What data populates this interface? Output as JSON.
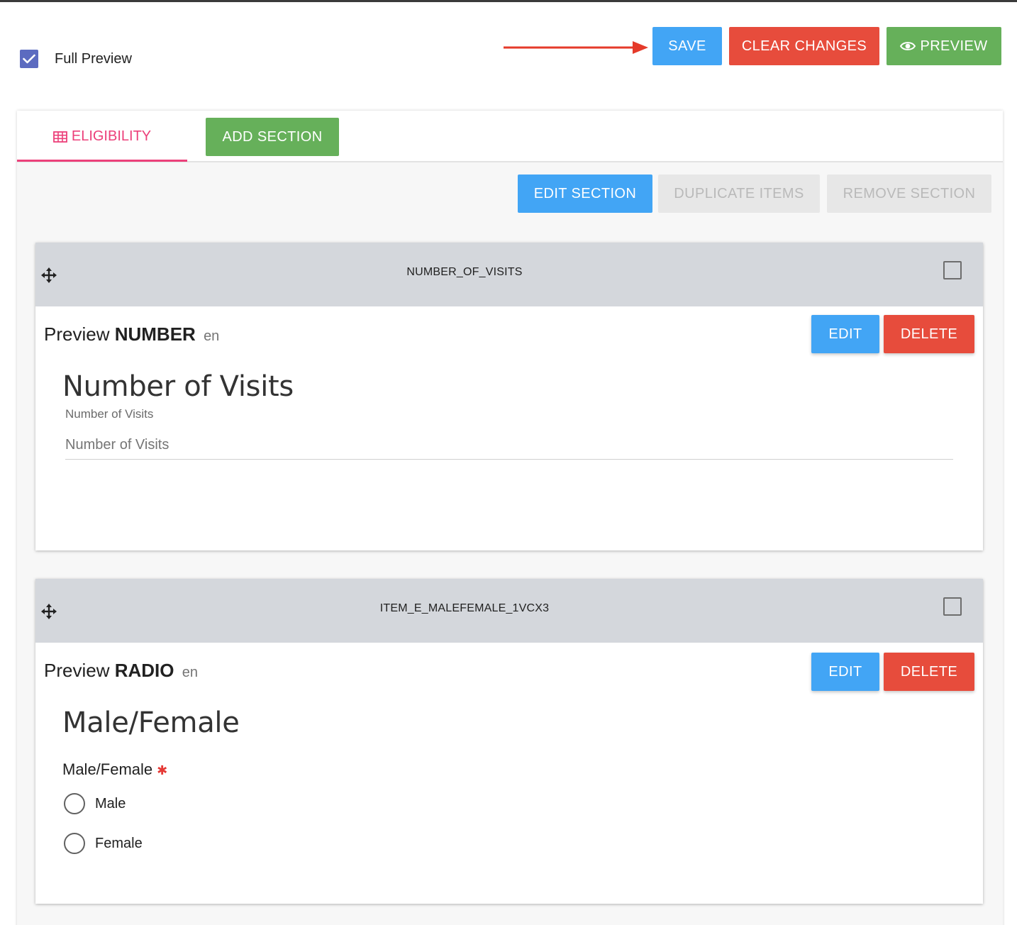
{
  "toolbar": {
    "full_preview_label": "Full Preview",
    "save_label": "SAVE",
    "clear_label": "CLEAR CHANGES",
    "preview_label": "PREVIEW"
  },
  "tabs": {
    "eligibility_label": "ELIGIBILITY",
    "add_section_label": "ADD SECTION"
  },
  "section_actions": {
    "edit_section": "EDIT SECTION",
    "duplicate_items": "DUPLICATE ITEMS",
    "remove_section": "REMOVE SECTION"
  },
  "items": [
    {
      "id": "NUMBER_OF_VISITS",
      "preview_word": "Preview",
      "type": "NUMBER",
      "lang": "en",
      "edit_label": "EDIT",
      "delete_label": "DELETE",
      "title": "Number of Visits",
      "label": "Number of Visits",
      "placeholder": "Number of Visits"
    },
    {
      "id": "ITEM_E_MALEFEMALE_1VCX3",
      "preview_word": "Preview",
      "type": "RADIO",
      "lang": "en",
      "edit_label": "EDIT",
      "delete_label": "DELETE",
      "title": "Male/Female",
      "question": "Male/Female",
      "required_mark": "✱",
      "options": [
        "Male",
        "Female"
      ]
    }
  ],
  "colors": {
    "blue": "#42a5f5",
    "red": "#e74c3c",
    "green": "#66b05a",
    "tab_accent": "#ec407a",
    "checkbox": "#5c6bc0"
  }
}
